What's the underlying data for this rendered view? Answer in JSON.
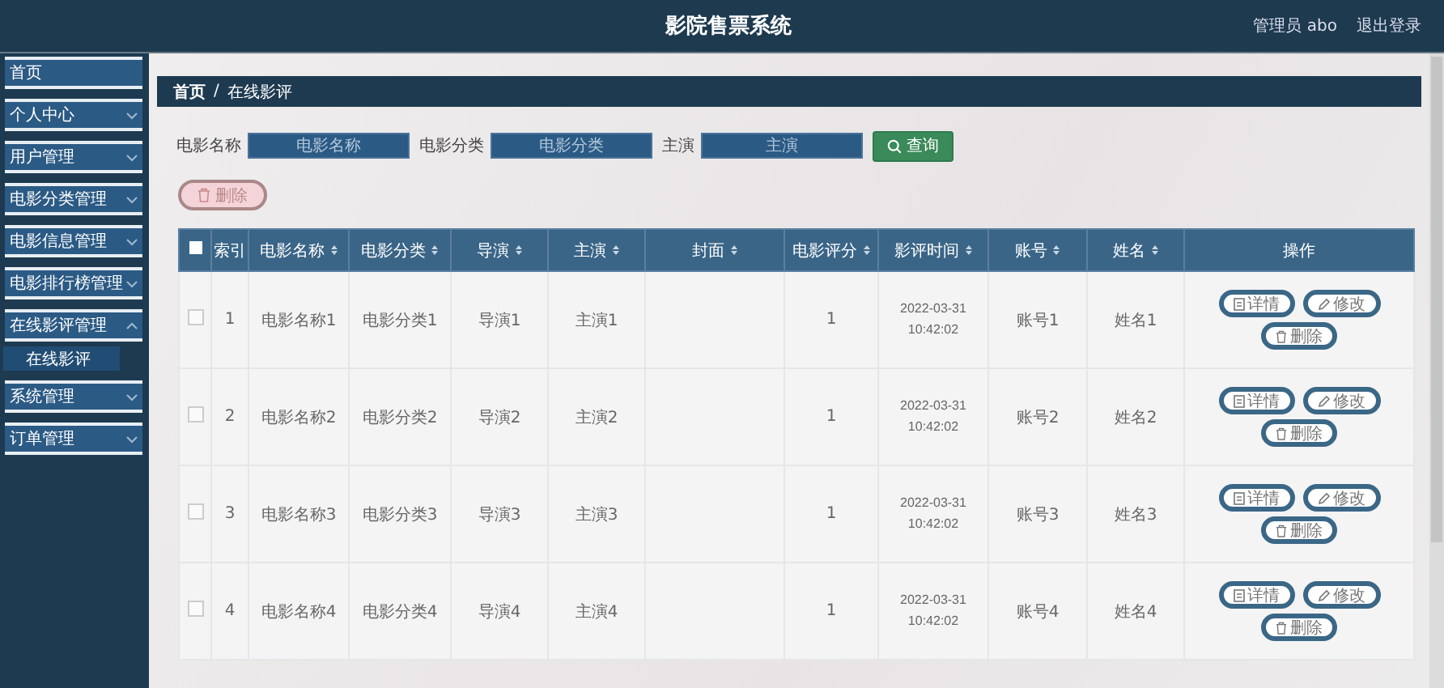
{
  "header": {
    "title": "影院售票系统",
    "user": "管理员 abo",
    "logout": "退出登录"
  },
  "sidebar": {
    "items": [
      {
        "label": "首页",
        "kind": "link"
      },
      {
        "label": "个人中心",
        "kind": "menu",
        "expanded": false
      },
      {
        "label": "用户管理",
        "kind": "menu",
        "expanded": false
      },
      {
        "label": "电影分类管理",
        "kind": "menu",
        "expanded": false
      },
      {
        "label": "电影信息管理",
        "kind": "menu",
        "expanded": false
      },
      {
        "label": "电影排行榜管理",
        "kind": "menu",
        "expanded": false
      },
      {
        "label": "在线影评管理",
        "kind": "menu",
        "expanded": true,
        "children": [
          {
            "label": "在线影评",
            "selected": true
          }
        ]
      },
      {
        "label": "系统管理",
        "kind": "menu",
        "expanded": false
      },
      {
        "label": "订单管理",
        "kind": "menu",
        "expanded": false
      }
    ]
  },
  "breadcrumb": [
    "首页",
    "/",
    "在线影评"
  ],
  "search": {
    "fields": [
      {
        "label": "电影名称",
        "placeholder": "电影名称"
      },
      {
        "label": "电影分类",
        "placeholder": "电影分类"
      },
      {
        "label": "主演",
        "placeholder": "主演"
      }
    ],
    "button": "查询"
  },
  "delete_button": "删除",
  "table": {
    "all_checked": false,
    "columns": [
      {
        "label": "索引",
        "kind": "plain"
      },
      {
        "label": "电影名称",
        "kind": "sortable"
      },
      {
        "label": "电影分类",
        "kind": "sortable"
      },
      {
        "label": "导演",
        "kind": "sortable"
      },
      {
        "label": "主演",
        "kind": "sortable"
      },
      {
        "label": "封面",
        "kind": "sortable"
      },
      {
        "label": "电影评分",
        "kind": "sortable"
      },
      {
        "label": "影评时间",
        "kind": "sortable"
      },
      {
        "label": "账号",
        "kind": "sortable"
      },
      {
        "label": "姓名",
        "kind": "sortable"
      },
      {
        "label": "操作",
        "kind": "plain"
      }
    ],
    "rows": [
      {
        "checked": false,
        "cells": [
          "1",
          "电影名称1",
          "电影分类1",
          "导演1",
          "主演1",
          "",
          "1",
          "2022-03-31 10:42:02",
          "账号1",
          "姓名1"
        ],
        "actions": [
          "详情",
          "修改",
          "删除"
        ]
      },
      {
        "checked": false,
        "cells": [
          "2",
          "电影名称2",
          "电影分类2",
          "导演2",
          "主演2",
          "",
          "1",
          "2022-03-31 10:42:02",
          "账号2",
          "姓名2"
        ],
        "actions": [
          "详情",
          "修改",
          "删除"
        ]
      },
      {
        "checked": false,
        "cells": [
          "3",
          "电影名称3",
          "电影分类3",
          "导演3",
          "主演3",
          "",
          "1",
          "2022-03-31 10:42:02",
          "账号3",
          "姓名3"
        ],
        "actions": [
          "详情",
          "修改",
          "删除"
        ]
      },
      {
        "checked": false,
        "cells": [
          "4",
          "电影名称4",
          "电影分类4",
          "导演4",
          "主演4",
          "",
          "1",
          "2022-03-31 10:42:02",
          "账号4",
          "姓名4"
        ],
        "actions": [
          "详情",
          "修改",
          "删除"
        ]
      }
    ]
  }
}
